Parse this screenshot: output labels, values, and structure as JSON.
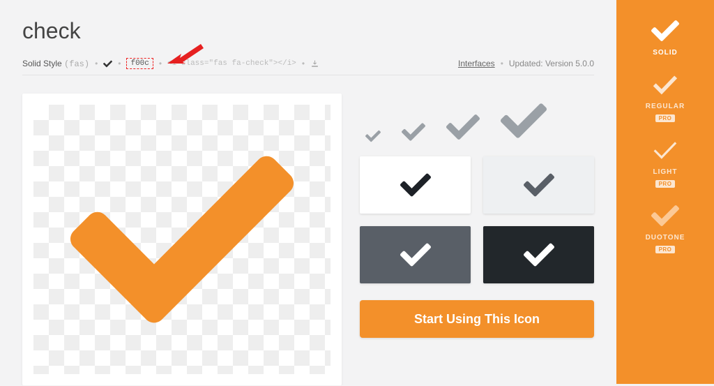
{
  "title": "check",
  "meta": {
    "style_label": "Solid Style",
    "fas_label": "(fas)",
    "unicode": "f00c",
    "html_snippet": "<i class=\"fas fa-check\"></i>",
    "category": "Interfaces",
    "updated_label": "Updated:",
    "updated_value": "Version 5.0.0"
  },
  "colors": {
    "accent": "#f3902a",
    "gray": "#9aa0a6",
    "dark": "#1d2127",
    "card_gray": "#595f67",
    "card_dark": "#22272b"
  },
  "cta_label": "Start Using This Icon",
  "sidebar": {
    "items": [
      {
        "label": "SOLID",
        "pro": false,
        "active": true
      },
      {
        "label": "REGULAR",
        "pro": true,
        "active": false
      },
      {
        "label": "LIGHT",
        "pro": true,
        "active": false
      },
      {
        "label": "DUOTONE",
        "pro": true,
        "active": false
      }
    ],
    "pro_label": "PRO"
  },
  "size_previews": [
    22,
    34,
    48,
    66
  ],
  "card_previews": [
    {
      "bg": "white",
      "check_color": "#1d2127"
    },
    {
      "bg": "light",
      "check_color": "#595f67"
    },
    {
      "bg": "gray",
      "check_color": "#ffffff"
    },
    {
      "bg": "dark",
      "check_color": "#ffffff"
    }
  ]
}
